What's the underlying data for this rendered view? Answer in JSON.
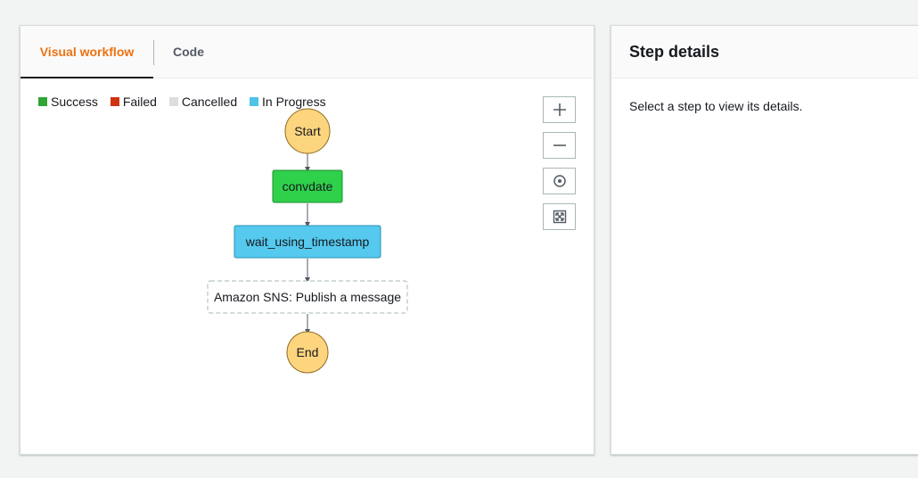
{
  "workflow_panel": {
    "tabs": [
      {
        "label": "Visual workflow",
        "active": true
      },
      {
        "label": "Code",
        "active": false
      }
    ],
    "legend": [
      {
        "label": "Success",
        "color": "#2ea534"
      },
      {
        "label": "Failed",
        "color": "#d13212"
      },
      {
        "label": "Cancelled",
        "color": "#dddddd"
      },
      {
        "label": "In Progress",
        "color": "#4fc3e8"
      }
    ],
    "zoom_controls": [
      {
        "name": "zoom-in",
        "icon": "plus-icon"
      },
      {
        "name": "zoom-out",
        "icon": "minus-icon"
      },
      {
        "name": "center",
        "icon": "target-icon"
      },
      {
        "name": "fit-to-screen",
        "icon": "expand-icon"
      }
    ],
    "graph": {
      "nodes": [
        {
          "label": "Start",
          "kind": "terminal",
          "status": "start"
        },
        {
          "label": "convdate",
          "kind": "state",
          "status": "Success"
        },
        {
          "label": "wait_using_timestamp",
          "kind": "state",
          "status": "In Progress"
        },
        {
          "label": "Amazon SNS: Publish a message",
          "kind": "state",
          "status": "Not started"
        },
        {
          "label": "End",
          "kind": "terminal",
          "status": "end"
        }
      ]
    }
  },
  "details_panel": {
    "title": "Step details",
    "hint": "Select a step to view its details."
  },
  "colors": {
    "accent": "#ec7211",
    "success": "#2ea534",
    "failed": "#d13212",
    "cancelled": "#dddddd",
    "in_progress": "#4fc3e8",
    "terminal": "#fdd57e"
  }
}
